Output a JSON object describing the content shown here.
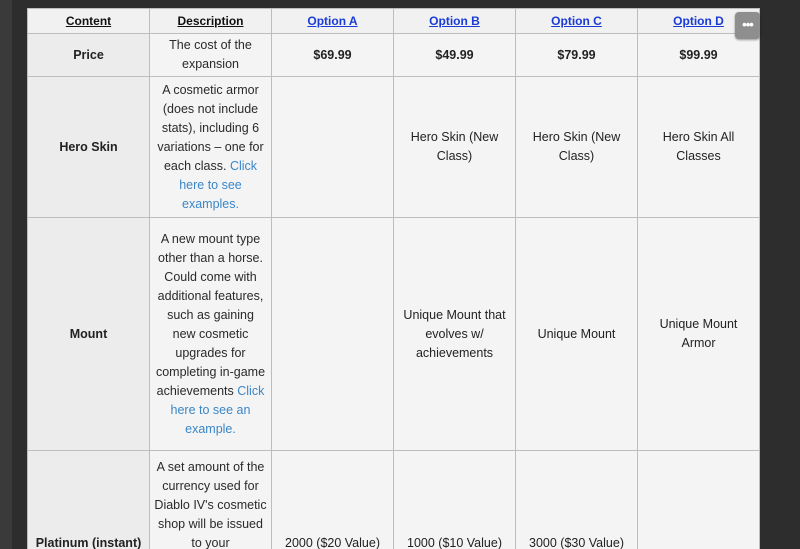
{
  "table": {
    "headers": [
      "Content",
      "Description",
      "Option A",
      "Option B",
      "Option C",
      "Option D"
    ],
    "rows": {
      "price": {
        "label": "Price",
        "description": "The cost of the expansion",
        "a": "$69.99",
        "b": "$49.99",
        "c": "$79.99",
        "d": "$99.99"
      },
      "hero_skin": {
        "label": "Hero Skin",
        "description": "A cosmetic armor (does not include stats), including 6 variations – one for each class.",
        "link": "Click here to see examples.",
        "a": "",
        "b": "Hero Skin (New Class)",
        "c": "Hero Skin (New Class)",
        "d": "Hero Skin All Classes"
      },
      "mount": {
        "label": "Mount",
        "description": "A new mount type other than a horse. Could come with additional features, such as gaining new cosmetic upgrades for completing in-game achievements",
        "link": "Click here to see an example.",
        "a": "",
        "b": "Unique Mount that evolves w/ achievements",
        "c": "Unique Mount",
        "d": "Unique Mount Armor"
      },
      "platinum": {
        "label": "Platinum (instant)",
        "description": "A set amount of the currency used for Diablo IV's cosmetic shop will be issued to your",
        "a": "2000 ($20 Value)",
        "b": "1000 ($10 Value)",
        "c": "3000 ($30 Value)",
        "d": ""
      }
    }
  },
  "more_button": {
    "label": "•••",
    "icon": "more-horizontal-icon"
  }
}
